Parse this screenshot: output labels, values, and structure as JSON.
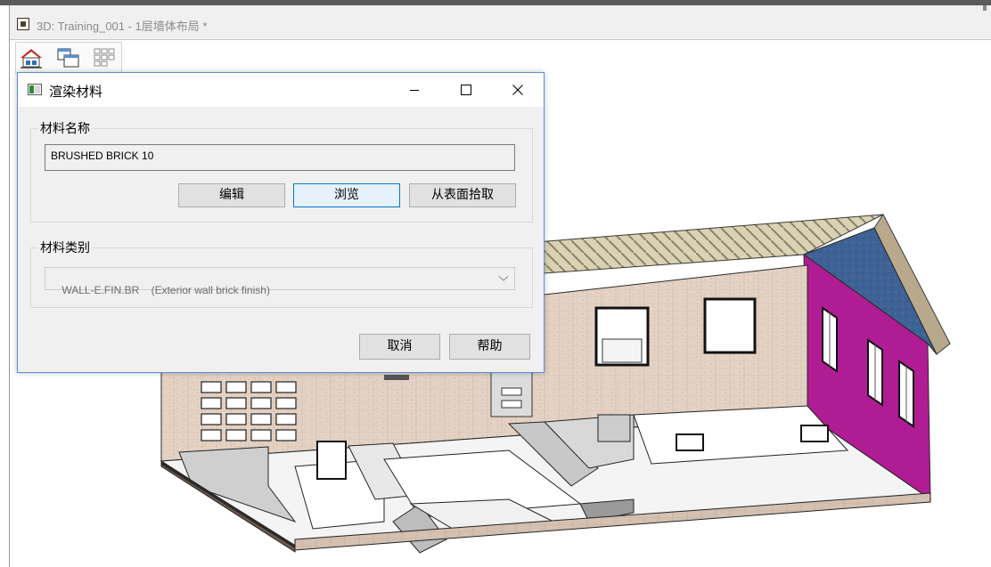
{
  "window": {
    "title": "3D: Training_001 - 1层墙体布局 *"
  },
  "toolbar": {
    "icons": [
      "home-icon",
      "windows-icon",
      "grid-icon"
    ]
  },
  "dialog": {
    "title": "渲染材料",
    "controls": [
      "minimize-icon",
      "maximize-icon",
      "close-icon"
    ],
    "material_name": {
      "label": "材料名称",
      "value": "BRUSHED BRICK 10",
      "buttons": {
        "edit": "编辑",
        "browse": "浏览",
        "pick": "从表面拾取"
      }
    },
    "material_category": {
      "label": "材料类别",
      "value": "WALL-E.FIN.BR    (Exterior wall brick finish)"
    },
    "footer": {
      "cancel": "取消",
      "help": "帮助"
    }
  },
  "colors": {
    "accent": "#0078d7",
    "dialog_bg": "#f0f0f0",
    "brick": "#e2cfc0",
    "magenta_wall": "#b01c94",
    "roof_blue": "#3e6294",
    "annotation_arrow": "#e53935"
  }
}
